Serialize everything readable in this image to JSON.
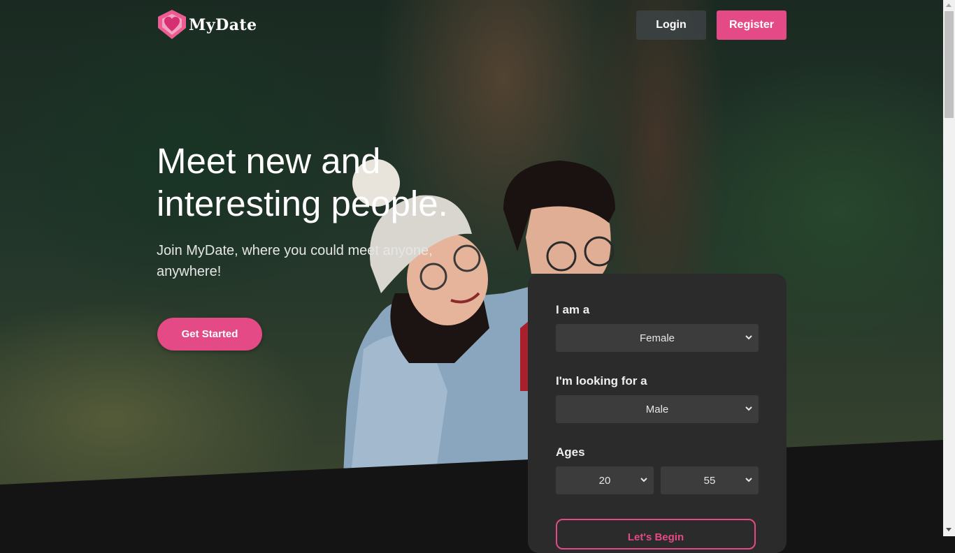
{
  "brand": {
    "name": "MyDate",
    "logo_icon": "heart-icon",
    "accent_color": "#e44a86"
  },
  "nav": {
    "login_label": "Login",
    "register_label": "Register"
  },
  "hero": {
    "headline": "Meet new and interesting people.",
    "subtitle": "Join MyDate, where you could meet anyone, anywhere!",
    "cta_label": "Get Started"
  },
  "form": {
    "gender_label": "I am a",
    "gender_value": "Female",
    "seeking_label": "I'm looking for a",
    "seeking_value": "Male",
    "ages_label": "Ages",
    "age_min_value": "20",
    "age_max_value": "55",
    "submit_label": "Let's Begin"
  }
}
